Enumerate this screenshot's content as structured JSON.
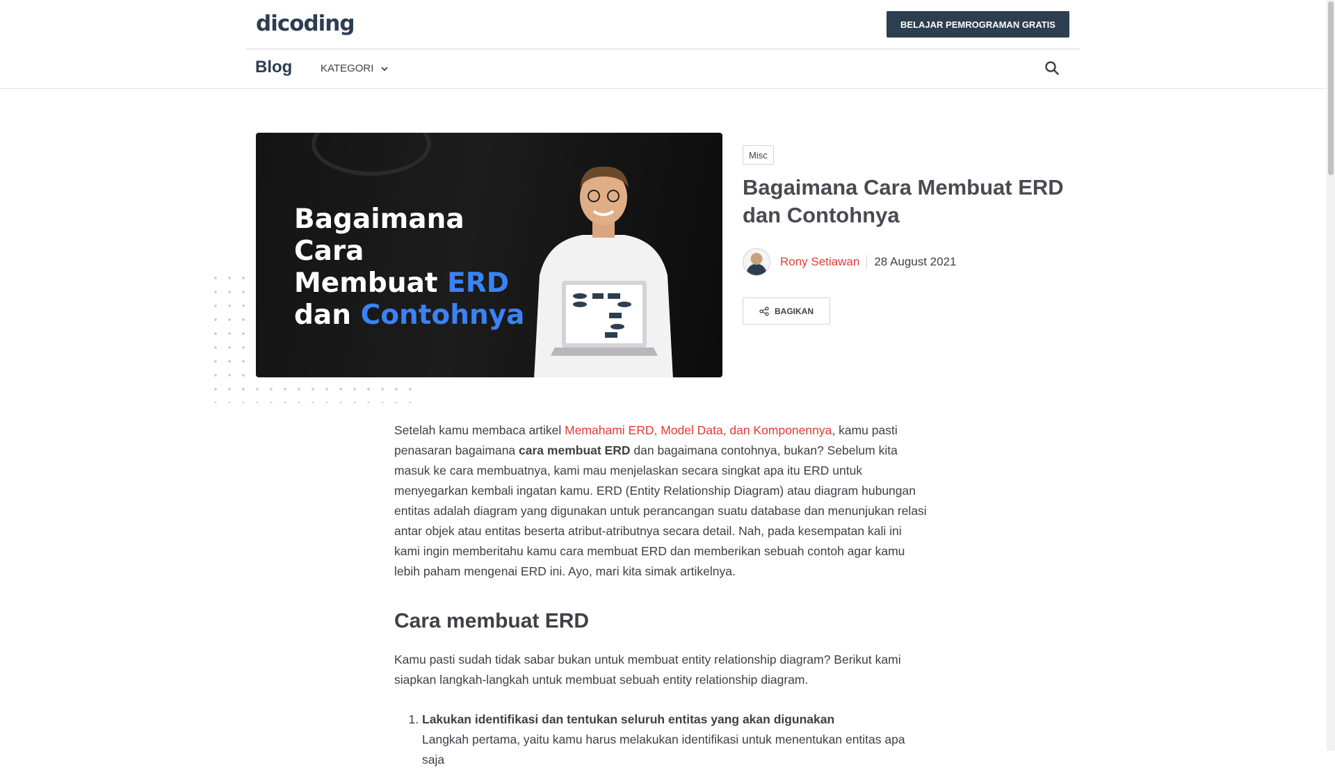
{
  "header": {
    "logo_text": "dicoding",
    "cta_label": "BELAJAR PEMROGRAMAN GRATIS"
  },
  "nav": {
    "blog_label": "Blog",
    "kategori_label": "KATEGORI"
  },
  "hero": {
    "line1": "Bagaimana Cara",
    "line2_a": "Membuat ",
    "line2_b": "ERD",
    "line3_a": "dan ",
    "line3_b": "Contohnya"
  },
  "article": {
    "tag": "Misc",
    "title": "Bagaimana Cara Membuat ERD dan Contohnya",
    "author": "Rony Setiawan",
    "date": "28 August 2021",
    "share_label": "BAGIKAN"
  },
  "content": {
    "intro_pre_link": "Setelah kamu membaca artikel ",
    "intro_link": "Memahami ERD, Model Data, dan Komponennya",
    "intro_post_link": ", kamu pasti penasaran bagaimana ",
    "intro_bold": "cara membuat ERD",
    "intro_rest": " dan bagaimana contohnya, bukan? Sebelum kita masuk ke cara membuatnya, kami mau menjelaskan secara singkat apa itu ERD untuk menyegarkan kembali ingatan kamu. ERD (Entity Relationship Diagram) atau diagram hubungan entitas adalah diagram yang digunakan untuk perancangan suatu database dan menunjukan relasi antar objek atau entitas beserta atribut-atributnya secara detail. Nah, pada kesempatan kali ini kami ingin memberitahu kamu cara membuat ERD dan memberikan sebuah contoh agar kamu lebih paham mengenai ERD ini. Ayo, mari kita simak artikelnya.",
    "section_heading": "Cara membuat ERD",
    "section_intro": "Kamu pasti sudah tidak sabar bukan untuk membuat entity relationship diagram?  Berikut kami siapkan langkah-langkah untuk membuat sebuah entity relationship diagram.",
    "step1_title": "Lakukan identifikasi dan tentukan seluruh entitas yang akan digunakan",
    "step1_text": "Langkah pertama, yaitu kamu harus melakukan identifikasi untuk menentukan entitas apa saja"
  },
  "colors": {
    "brand_navy": "#2d3e50",
    "link_red": "#e53935",
    "hero_highlight_blue": "#3b82f6"
  }
}
